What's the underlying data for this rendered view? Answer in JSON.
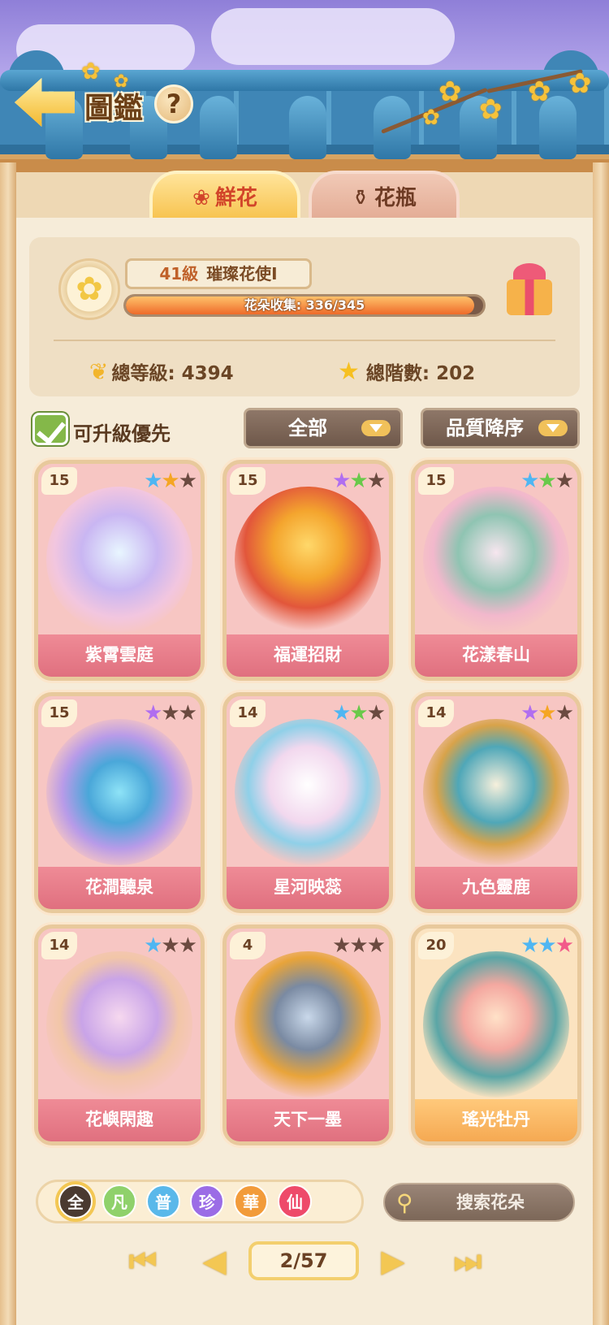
{
  "header": {
    "title": "圖鑑",
    "help_symbol": "?"
  },
  "tabs": [
    {
      "label": "鮮花",
      "icon": "rose-icon",
      "active": true
    },
    {
      "label": "花瓶",
      "icon": "vase-icon",
      "active": false
    }
  ],
  "profile": {
    "level": "41級",
    "rank_title": "璀璨花使Ⅰ",
    "collection_label": "花朵收集: 336/345",
    "collection_progress": 0.974,
    "total_level_label": "總等級: 4394",
    "total_stars_label": "總階數: 202"
  },
  "filters": {
    "upgrade_first_label": "可升級優先",
    "upgrade_first_checked": true,
    "category_label": "全部",
    "sort_label": "品質降序"
  },
  "cards": [
    {
      "level": "15",
      "name": "紫霄雲庭",
      "stars": [
        "#4fb6f2",
        "#f5a623",
        "#6b4a40"
      ],
      "theme": "pink"
    },
    {
      "level": "15",
      "name": "福運招財",
      "stars": [
        "#b06ef0",
        "#69c94a",
        "#6b4a40"
      ],
      "theme": "pink"
    },
    {
      "level": "15",
      "name": "花漾春山",
      "stars": [
        "#4fb6f2",
        "#69c94a",
        "#6b4a40"
      ],
      "theme": "pink"
    },
    {
      "level": "15",
      "name": "花澗聽泉",
      "stars": [
        "#b06ef0",
        "#6b4a40",
        "#6b4a40"
      ],
      "theme": "pink"
    },
    {
      "level": "14",
      "name": "星河映蕊",
      "stars": [
        "#4fb6f2",
        "#69c94a",
        "#6b4a40"
      ],
      "theme": "pink"
    },
    {
      "level": "14",
      "name": "九色靈鹿",
      "stars": [
        "#b06ef0",
        "#f5a623",
        "#6b4a40"
      ],
      "theme": "pink"
    },
    {
      "level": "14",
      "name": "花嶼閑趣",
      "stars": [
        "#4fb6f2",
        "#6b4a40",
        "#6b4a40"
      ],
      "theme": "pink"
    },
    {
      "level": "4",
      "name": "天下一墨",
      "stars": [
        "#6b4a40",
        "#6b4a40",
        "#6b4a40"
      ],
      "theme": "pink"
    },
    {
      "level": "20",
      "name": "瑤光牡丹",
      "stars": [
        "#4fb6f2",
        "#4fb6f2",
        "#f25a8a"
      ],
      "theme": "gold"
    }
  ],
  "rarity_filters": [
    {
      "label": "全",
      "color": "#4a3a30",
      "selected": true
    },
    {
      "label": "凡",
      "color": "#8fd16b",
      "selected": false
    },
    {
      "label": "普",
      "color": "#5ab8ea",
      "selected": false
    },
    {
      "label": "珍",
      "color": "#9b6ce6",
      "selected": false
    },
    {
      "label": "華",
      "color": "#f29b3a",
      "selected": false
    },
    {
      "label": "仙",
      "color": "#ee4a6a",
      "selected": false
    }
  ],
  "search": {
    "placeholder": "搜索花朵"
  },
  "pager": {
    "page_label": "2/57",
    "first": "⏮",
    "prev": "◀",
    "next": "▶",
    "last": "⏭"
  }
}
